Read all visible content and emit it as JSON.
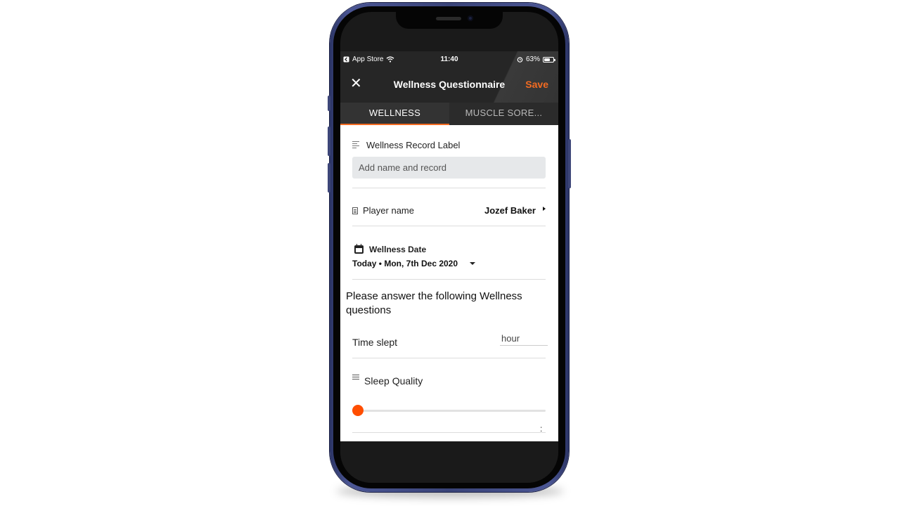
{
  "status_bar": {
    "back_app": "App Store",
    "time": "11:40",
    "battery": "63%",
    "battery_level": 0.63
  },
  "header": {
    "close_icon": "close-icon",
    "title": "Wellness Questionnaire",
    "save_label": "Save",
    "accent_color": "#f36b21"
  },
  "tabs": [
    {
      "label": "WELLNESS",
      "active": true
    },
    {
      "label": "MUSCLE SORE...",
      "active": false
    }
  ],
  "record": {
    "label": "Wellness Record Label",
    "placeholder": "Add name and record"
  },
  "player": {
    "label": "Player name",
    "value": "Jozef Baker"
  },
  "date": {
    "label": "Wellness Date",
    "value": "Today • Mon, 7th Dec 2020"
  },
  "questions": {
    "prompt": "Please answer the following Wellness questions",
    "time_slept": {
      "label": "Time slept",
      "placeholder": "hour"
    },
    "sleep_quality": {
      "label": "Sleep Quality",
      "value_text": ":",
      "level": 0
    }
  }
}
